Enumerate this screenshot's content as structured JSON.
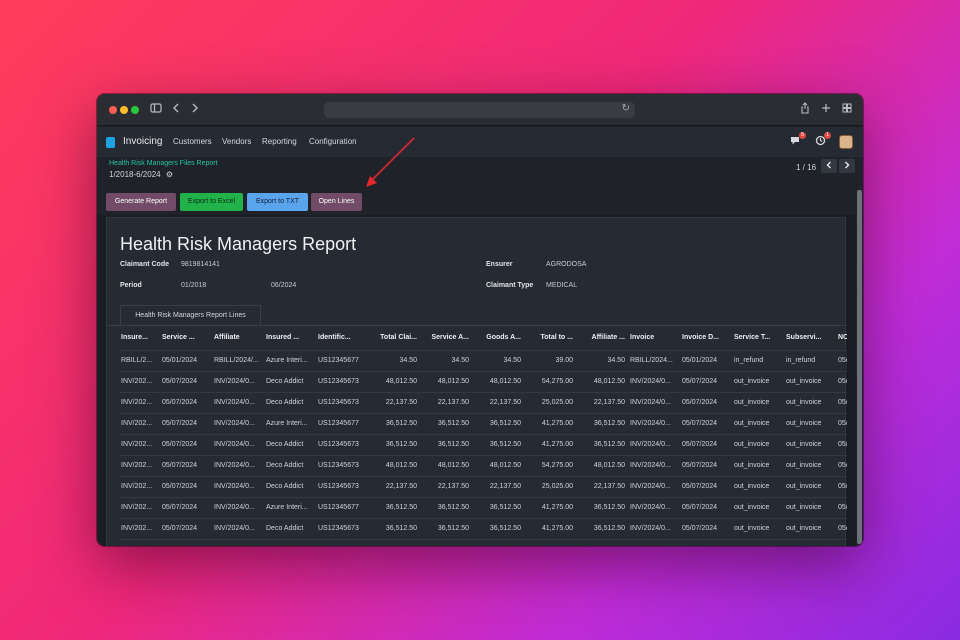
{
  "browser": {
    "reload_icon": "↻"
  },
  "navbar": {
    "app_name": "Invoicing",
    "menu": [
      "Customers",
      "Vendors",
      "Reporting",
      "Configuration"
    ],
    "messages_count": "5",
    "activities_count": "1"
  },
  "control_panel": {
    "breadcrumb": "Health Risk Managers Files Report",
    "period": "1/2018-6/2024",
    "pager": "1 / 16"
  },
  "actions": {
    "generate": "Generate Report",
    "excel": "Export to Excel",
    "txt": "Export to TXT",
    "open_lines": "Open Lines"
  },
  "report": {
    "title": "Health Risk Managers Report",
    "claimant_code_label": "Claimant Code",
    "claimant_code": "9819814141",
    "ensurer_label": "Ensurer",
    "ensurer": "AGRODOSA",
    "period_label": "Period",
    "period_from": "01/2018",
    "period_to": "06/2024",
    "claimant_type_label": "Claimant Type",
    "claimant_type": "MEDICAL",
    "tab": "Health Risk Managers Report Lines"
  },
  "table": {
    "headers": [
      "Insure...",
      "Service ...",
      "Affiliate",
      "Insured ...",
      "Identific...",
      "Total Clai...",
      "Service A...",
      "Goods A...",
      "Total to ...",
      "Affiliate ...",
      "Invoice",
      "Invoice D...",
      "Service T...",
      "Subservi...",
      "NCF"
    ],
    "rows": [
      [
        "RBILL/2...",
        "05/01/2024",
        "RBILL/2024/...",
        "Azure Interi...",
        "US12345677",
        "34.50",
        "34.50",
        "34.50",
        "39.00",
        "34.50",
        "RBILL/2024...",
        "05/01/2024",
        "in_refund",
        "in_refund",
        "05/"
      ],
      [
        "INV/202...",
        "05/07/2024",
        "INV/2024/0...",
        "Deco Addict",
        "US12345673",
        "48,012.50",
        "48,012.50",
        "48,012.50",
        "54,275.00",
        "48,012.50",
        "INV/2024/0...",
        "05/07/2024",
        "out_invoice",
        "out_invoice",
        "05/"
      ],
      [
        "INV/202...",
        "05/07/2024",
        "INV/2024/0...",
        "Deco Addict",
        "US12345673",
        "22,137.50",
        "22,137.50",
        "22,137.50",
        "25,025.00",
        "22,137.50",
        "INV/2024/0...",
        "05/07/2024",
        "out_invoice",
        "out_invoice",
        "05/"
      ],
      [
        "INV/202...",
        "05/07/2024",
        "INV/2024/0...",
        "Azure Interi...",
        "US12345677",
        "36,512.50",
        "36,512.50",
        "36,512.50",
        "41,275.00",
        "36,512.50",
        "INV/2024/0...",
        "05/07/2024",
        "out_invoice",
        "out_invoice",
        "05/"
      ],
      [
        "INV/202...",
        "05/07/2024",
        "INV/2024/0...",
        "Deco Addict",
        "US12345673",
        "36,512.50",
        "36,512.50",
        "36,512.50",
        "41,275.00",
        "36,512.50",
        "INV/2024/0...",
        "05/07/2024",
        "out_invoice",
        "out_invoice",
        "05/"
      ],
      [
        "INV/202...",
        "05/07/2024",
        "INV/2024/0...",
        "Deco Addict",
        "US12345673",
        "48,012.50",
        "48,012.50",
        "48,012.50",
        "54,275.00",
        "48,012.50",
        "INV/2024/0...",
        "05/07/2024",
        "out_invoice",
        "out_invoice",
        "05/"
      ],
      [
        "INV/202...",
        "05/07/2024",
        "INV/2024/0...",
        "Deco Addict",
        "US12345673",
        "22,137.50",
        "22,137.50",
        "22,137.50",
        "25,025.00",
        "22,137.50",
        "INV/2024/0...",
        "05/07/2024",
        "out_invoice",
        "out_invoice",
        "05/"
      ],
      [
        "INV/202...",
        "05/07/2024",
        "INV/2024/0...",
        "Azure Interi...",
        "US12345677",
        "36,512.50",
        "36,512.50",
        "36,512.50",
        "41,275.00",
        "36,512.50",
        "INV/2024/0...",
        "05/07/2024",
        "out_invoice",
        "out_invoice",
        "05/"
      ],
      [
        "INV/202...",
        "05/07/2024",
        "INV/2024/0...",
        "Deco Addict",
        "US12345673",
        "36,512.50",
        "36,512.50",
        "36,512.50",
        "41,275.00",
        "36,512.50",
        "INV/2024/0...",
        "05/07/2024",
        "out_invoice",
        "out_invoice",
        "05/"
      ]
    ],
    "numeric_columns": [
      5,
      6,
      7,
      8,
      9
    ]
  },
  "colors": {
    "primary_button": "#714b67",
    "excel_button": "#21b34a",
    "txt_button": "#5aa4ee",
    "annotation_arrow": "#e0282e"
  }
}
